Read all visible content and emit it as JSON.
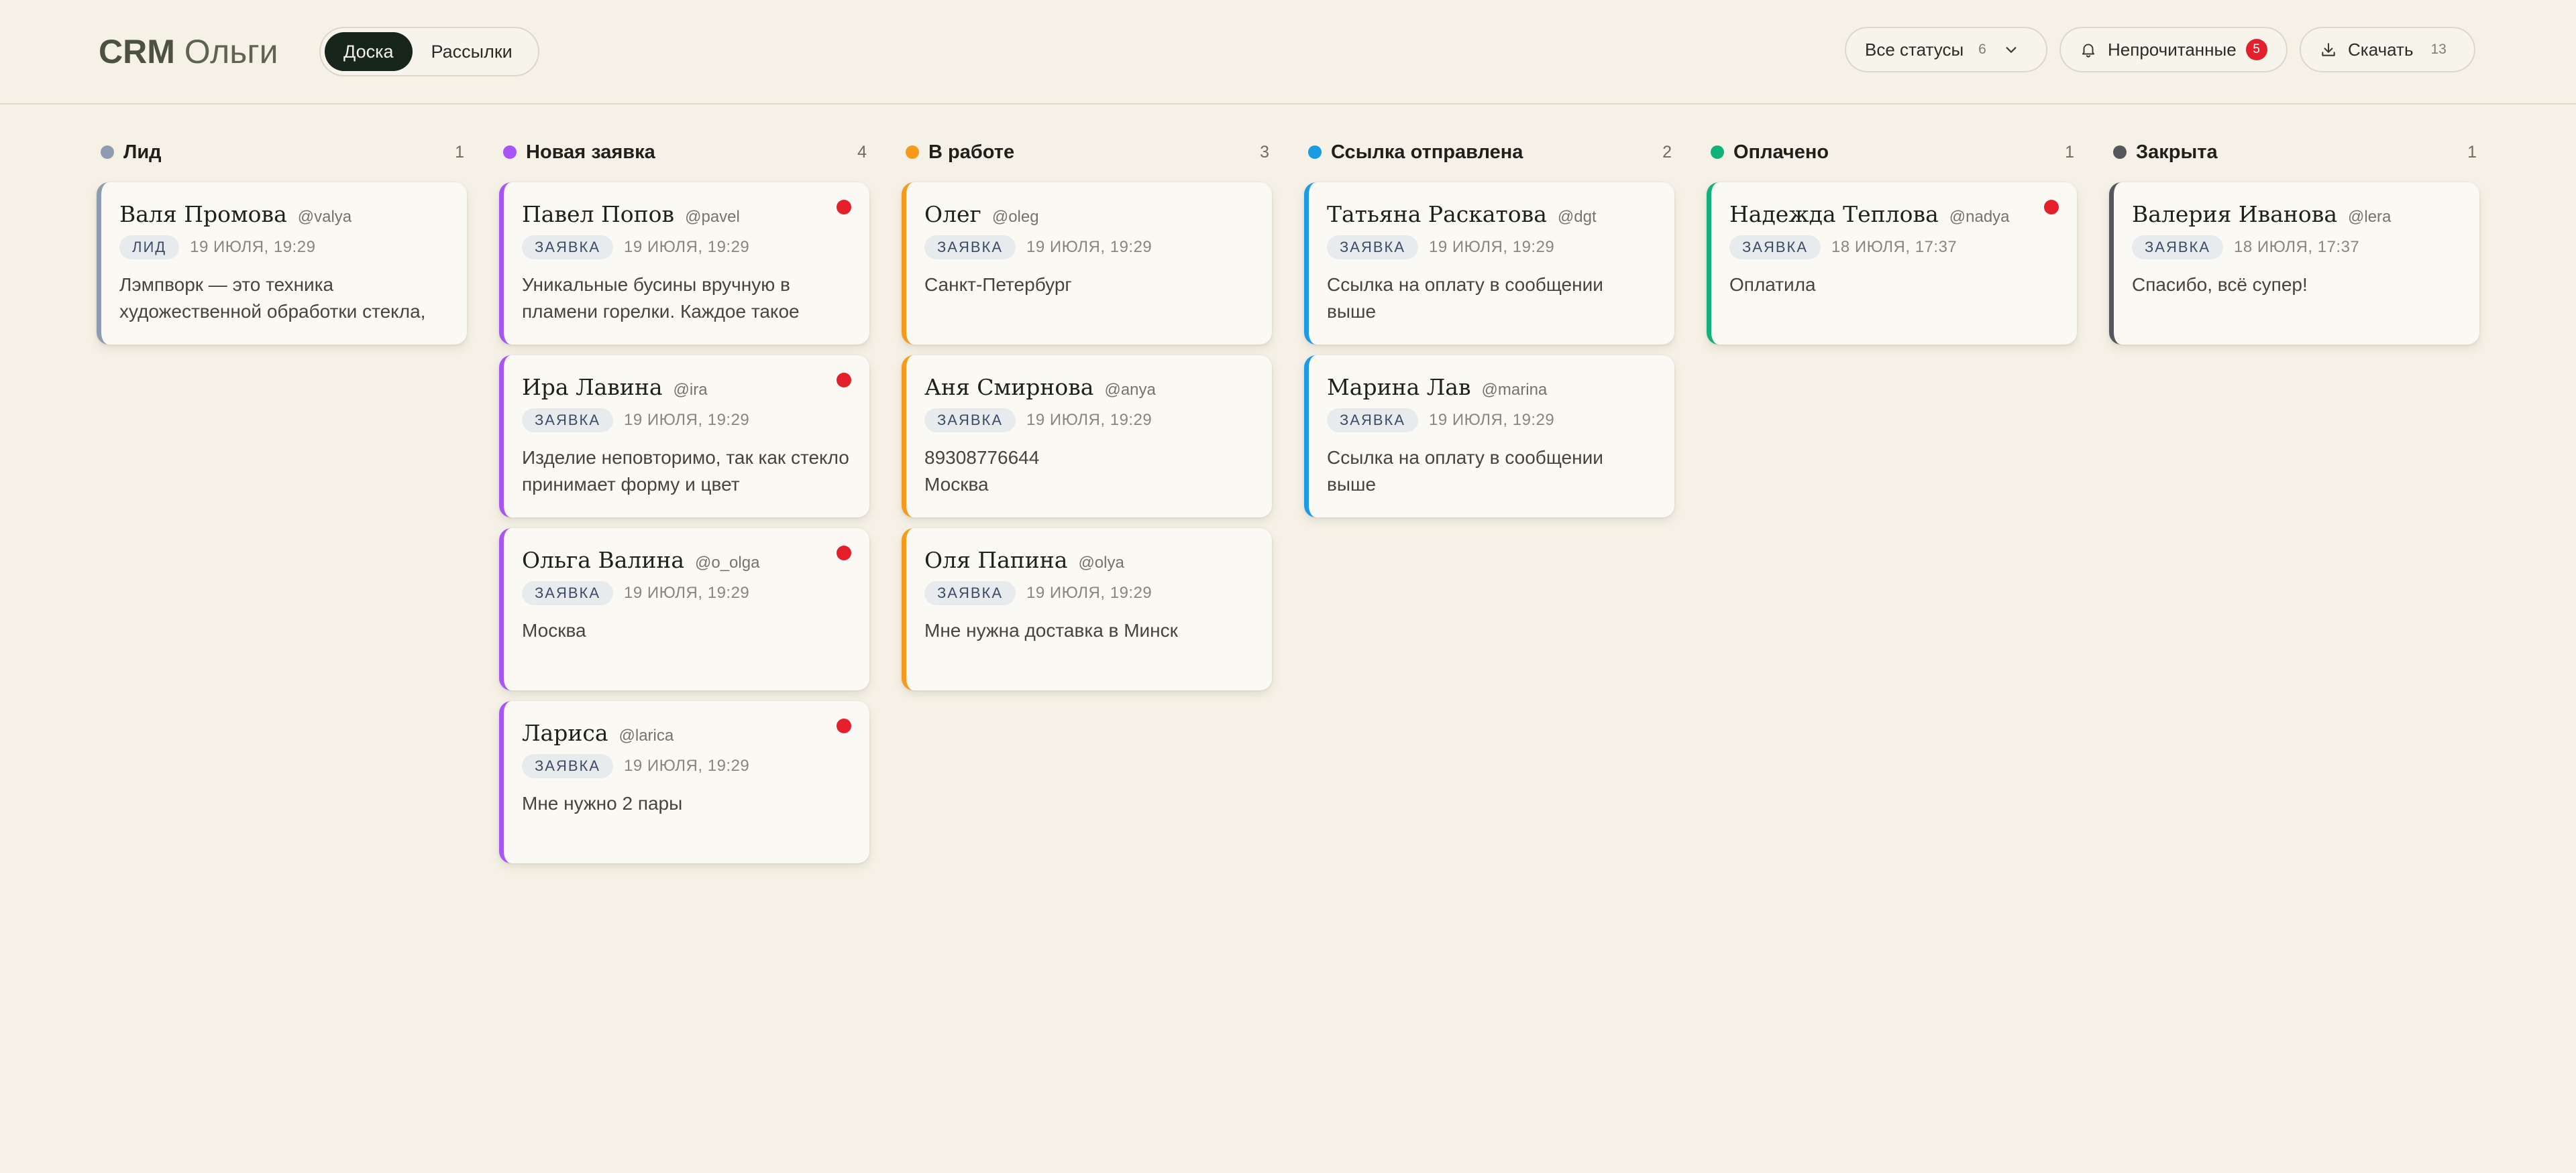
{
  "header": {
    "logo_strong": "CRM",
    "logo_light": "Ольги",
    "tabs": [
      {
        "label": "Доска",
        "active": true
      },
      {
        "label": "Рассылки",
        "active": false
      }
    ],
    "status_filter": {
      "label": "Все статусы",
      "count": "6"
    },
    "unread": {
      "label": "Непрочитанные",
      "badge": "5"
    },
    "download": {
      "label": "Скачать",
      "count": "13"
    },
    "colors": {
      "active_tab_bg": "#18251a",
      "badge": "#e5202d"
    }
  },
  "columns": [
    {
      "title": "Лид",
      "count": "1",
      "color": "#8e9cb0",
      "cards": [
        {
          "name": "Валя Промова",
          "username": "@valya",
          "tag": "ЛИД",
          "date": "19 ИЮЛЯ, 19:29",
          "text": "Лэмпворк — это техника художественной обработки стекла,",
          "unread": false
        }
      ]
    },
    {
      "title": "Новая заявка",
      "count": "4",
      "color": "#a855f7",
      "cards": [
        {
          "name": "Павел Попов",
          "username": "@pavel",
          "tag": "ЗАЯВКА",
          "date": "19 ИЮЛЯ, 19:29",
          "text": "Уникальные бусины вручную в пламени горелки. Каждое такое",
          "unread": true
        },
        {
          "name": "Ира Лавина",
          "username": "@ira",
          "tag": "ЗАЯВКА",
          "date": "19 ИЮЛЯ, 19:29",
          "text": "Изделие неповторимо, так как стекло принимает форму и цвет",
          "unread": true
        },
        {
          "name": "Ольга Валина",
          "username": "@o_olga",
          "tag": "ЗАЯВКА",
          "date": "19 ИЮЛЯ, 19:29",
          "text": "Москва",
          "unread": true
        },
        {
          "name": "Лариса",
          "username": "@larica",
          "tag": "ЗАЯВКА",
          "date": "19 ИЮЛЯ, 19:29",
          "text": "Мне нужно 2 пары",
          "unread": true
        }
      ]
    },
    {
      "title": "В работе",
      "count": "3",
      "color": "#f59a1b",
      "cards": [
        {
          "name": "Олег",
          "username": "@oleg",
          "tag": "ЗАЯВКА",
          "date": "19 ИЮЛЯ, 19:29",
          "text": "Санкт-Петербург",
          "unread": false
        },
        {
          "name": "Аня Смирнова",
          "username": "@anya",
          "tag": "ЗАЯВКА",
          "date": "19 ИЮЛЯ, 19:29",
          "text": "89308776644\nМосква",
          "unread": false
        },
        {
          "name": "Оля Папина",
          "username": "@olya",
          "tag": "ЗАЯВКА",
          "date": "19 ИЮЛЯ, 19:29",
          "text": "Мне нужна доставка в Минск",
          "unread": false
        }
      ]
    },
    {
      "title": "Ссылка отправлена",
      "count": "2",
      "color": "#1a9be6",
      "cards": [
        {
          "name": "Татьяна Раскатова",
          "username": "@dgt",
          "tag": "ЗАЯВКА",
          "date": "19 ИЮЛЯ, 19:29",
          "text": "Ссылка на оплату в сообщении выше",
          "unread": false
        },
        {
          "name": "Марина Лав",
          "username": "@marina",
          "tag": "ЗАЯВКА",
          "date": "19 ИЮЛЯ, 19:29",
          "text": "Ссылка на оплату в сообщении выше",
          "unread": false
        }
      ]
    },
    {
      "title": "Оплачено",
      "count": "1",
      "color": "#10b27a",
      "cards": [
        {
          "name": "Надежда Теплова",
          "username": "@nadya",
          "tag": "ЗАЯВКА",
          "date": "18 ИЮЛЯ, 17:37",
          "text": "Оплатила",
          "unread": true
        }
      ]
    },
    {
      "title": "Закрыта",
      "count": "1",
      "color": "#55575b",
      "cards": [
        {
          "name": "Валерия Иванова",
          "username": "@lera",
          "tag": "ЗАЯВКА",
          "date": "18 ИЮЛЯ, 17:37",
          "text": "Спасибо, всё супер!",
          "unread": false
        }
      ]
    }
  ]
}
